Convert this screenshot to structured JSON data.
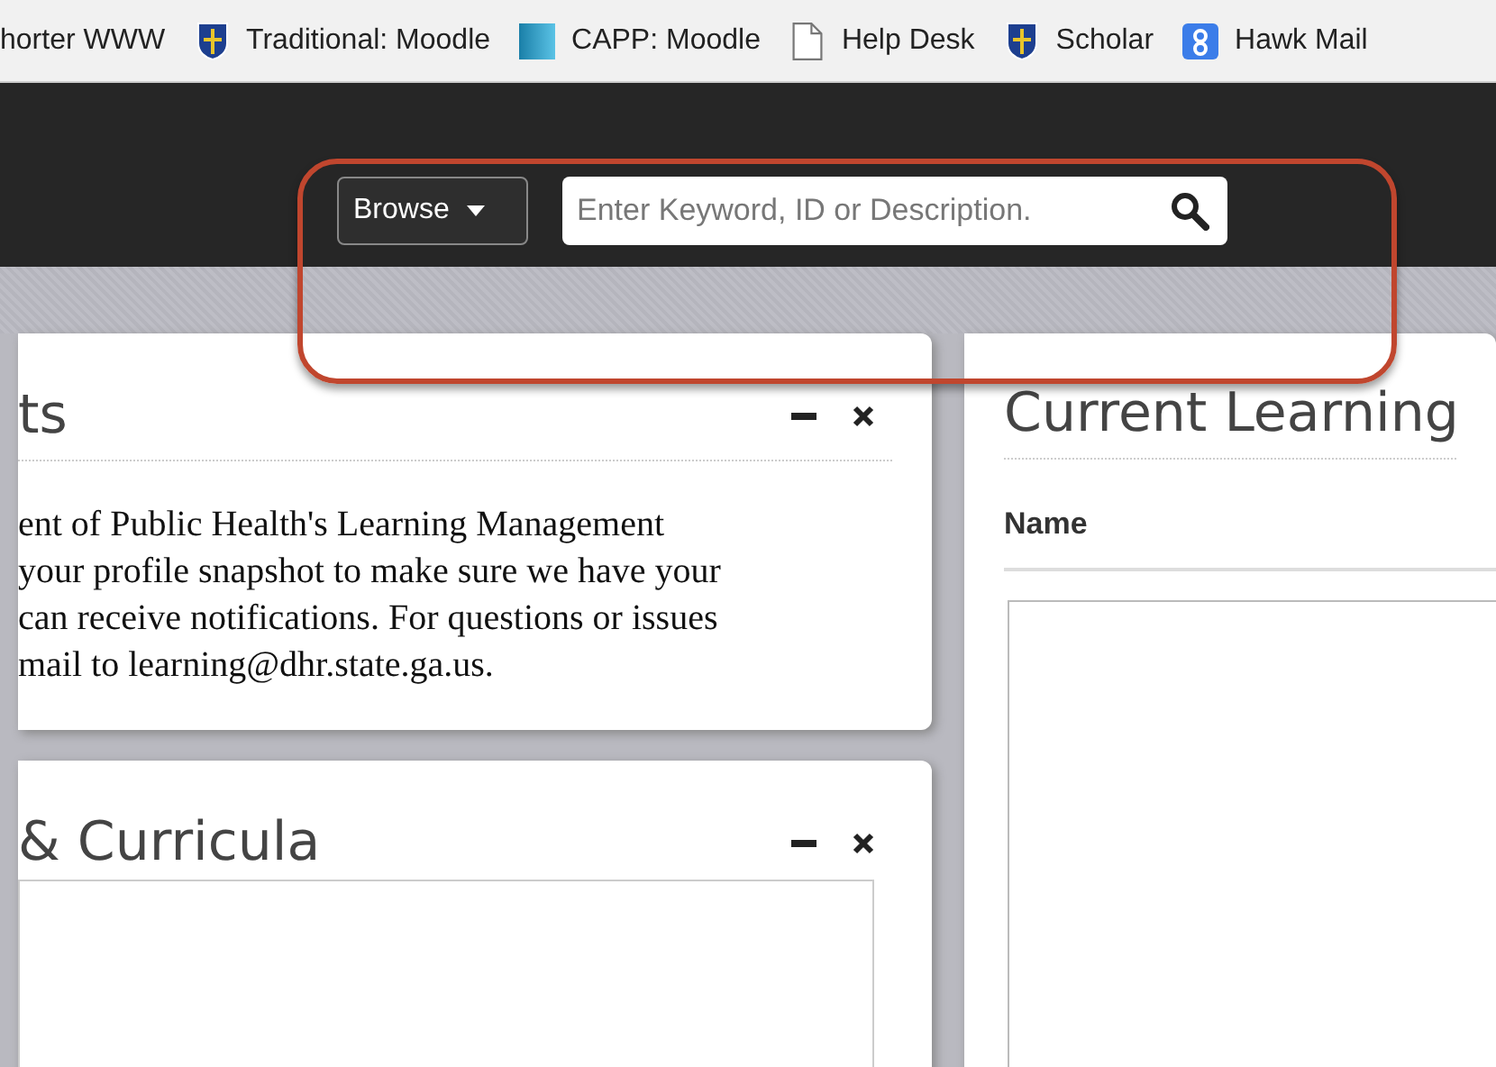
{
  "bookmarks": [
    {
      "label": "horter WWW",
      "kind": "none"
    },
    {
      "label": "Traditional: Moodle",
      "kind": "shield"
    },
    {
      "label": "CAPP: Moodle",
      "kind": "gradient"
    },
    {
      "label": "Help Desk",
      "kind": "page"
    },
    {
      "label": "Scholar",
      "kind": "shield"
    },
    {
      "label": "Hawk Mail",
      "kind": "badge"
    }
  ],
  "header": {
    "browse": "Browse",
    "search": {
      "placeholder": "Enter Keyword, ID or Description."
    }
  },
  "left_panels": [
    {
      "title": "ts",
      "lines": [
        "ent of Public Health's Learning Management",
        "your profile snapshot to make sure we have your",
        "can receive notifications. For questions or issues",
        "mail to learning@dhr.state.ga.us."
      ]
    },
    {
      "title": "& Curricula"
    }
  ],
  "right_panel": {
    "title": "Current Learning",
    "column": "Name"
  }
}
